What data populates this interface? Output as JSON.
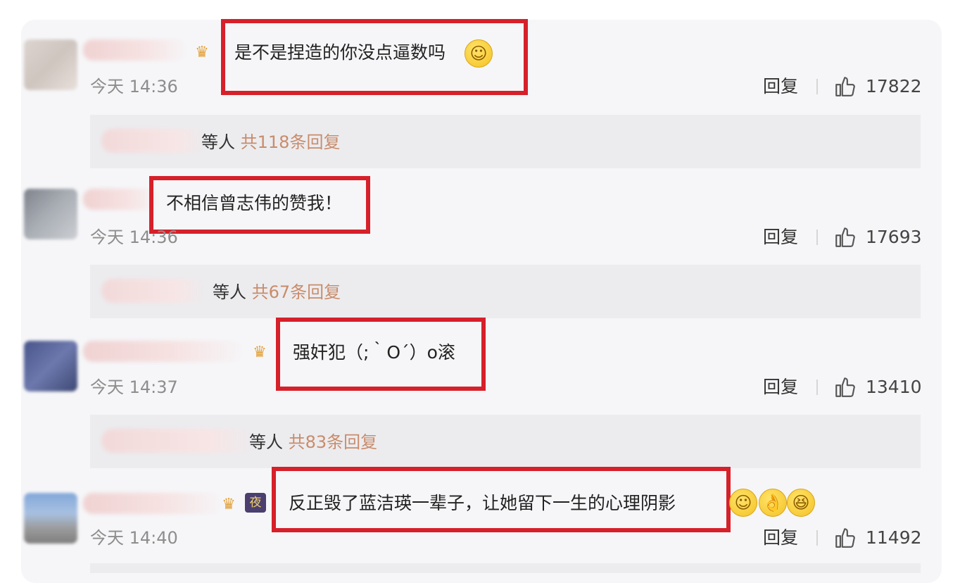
{
  "comments": [
    {
      "text": "是不是捏造的你没点逼数吗",
      "emojis": [
        "smile"
      ],
      "time": "今天 14:36",
      "reply_label": "回复",
      "likes": "17822",
      "sub_replies": {
        "who": "等人",
        "count_text": "共118条回复"
      }
    },
    {
      "text": "不相信曾志伟的赞我！",
      "emojis": [],
      "time": "今天 14:36",
      "reply_label": "回复",
      "likes": "17693",
      "sub_replies": {
        "who": "等人",
        "count_text": "共67条回复"
      }
    },
    {
      "text": "强奸犯（;｀O´）o滚",
      "emojis": [],
      "time": "今天 14:37",
      "reply_label": "回复",
      "likes": "13410",
      "sub_replies": {
        "who": "等人",
        "count_text": "共83条回复"
      }
    },
    {
      "text": "反正毁了蓝洁瑛一辈子，让她留下一生的心理阴影",
      "emojis": [
        "smile",
        "ok-hand",
        "grin"
      ],
      "night_badge": "夜",
      "time": "今天 14:40",
      "reply_label": "回复",
      "likes": "11492"
    }
  ],
  "colors": {
    "highlight_box": "#d6202a",
    "reply_count": "#c98c6b",
    "timestamp": "#8d8d8d",
    "card_bg": "#f6f6f8",
    "sub_reply_bg": "#ececef"
  },
  "icons": {
    "like": "thumbs-up-icon",
    "badge": "crown-badge-icon",
    "emoji": "smile-emoji-icon"
  }
}
